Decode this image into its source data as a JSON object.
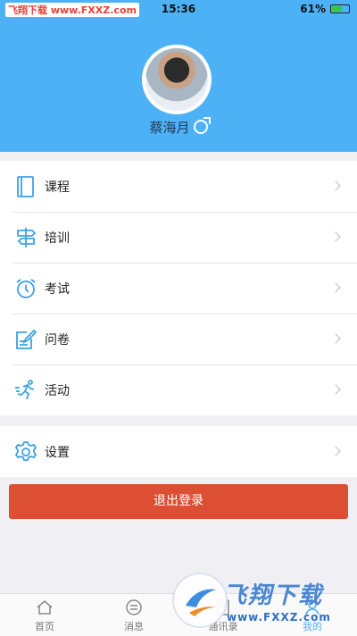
{
  "status_bar": {
    "watermark": "飞翔下载 www.FXXZ.com",
    "time": "15:36",
    "battery": "61%",
    "battery_level": 0.61
  },
  "profile": {
    "username": "蔡海月",
    "gender_icon": "male-icon"
  },
  "menu": {
    "items": [
      {
        "label": "课程",
        "icon": "book-icon"
      },
      {
        "label": "培训",
        "icon": "signpost-icon"
      },
      {
        "label": "考试",
        "icon": "alarm-clock-icon"
      },
      {
        "label": "问卷",
        "icon": "edit-form-icon"
      },
      {
        "label": "活动",
        "icon": "running-icon"
      }
    ],
    "settings": {
      "label": "设置",
      "icon": "gear-icon"
    }
  },
  "logout_label": "退出登录",
  "tabbar": {
    "items": [
      {
        "label": "首页",
        "icon": "home-icon"
      },
      {
        "label": "消息",
        "icon": "message-icon"
      },
      {
        "label": "通讯录",
        "icon": "contacts-icon"
      },
      {
        "label": "我的",
        "icon": "person-icon",
        "active": true
      }
    ]
  },
  "watermark": {
    "text": "飞翔下载",
    "url": "www.FXXZ.com"
  },
  "colors": {
    "header": "#4db2f5",
    "icon": "#3aa3e3",
    "logout": "#dd4f33"
  }
}
